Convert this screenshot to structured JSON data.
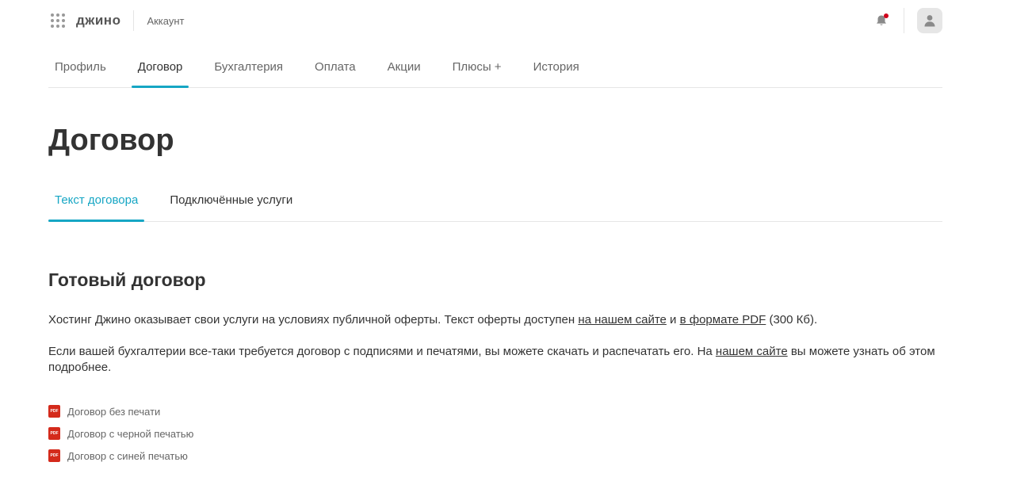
{
  "header": {
    "apps_icon": "apps-grid-icon",
    "logo": "джино",
    "account_label": "Аккаунт",
    "notification_icon": "bell-icon",
    "avatar_icon": "user-icon",
    "notification_dot_color": "#d0021b"
  },
  "nav": {
    "items": [
      {
        "label": "Профиль",
        "active": false
      },
      {
        "label": "Договор",
        "active": true
      },
      {
        "label": "Бухгалтерия",
        "active": false
      },
      {
        "label": "Оплата",
        "active": false
      },
      {
        "label": "Акции",
        "active": false
      },
      {
        "label": "Плюсы +",
        "active": false
      },
      {
        "label": "История",
        "active": false
      }
    ],
    "accent_color": "#16a6c4"
  },
  "page": {
    "title": "Договор"
  },
  "subnav": {
    "items": [
      {
        "label": "Текст договора",
        "active": true
      },
      {
        "label": "Подключённые услуги",
        "active": false
      }
    ]
  },
  "content": {
    "section_title": "Готовый договор",
    "para1": {
      "text_before": "Хостинг Джино оказывает свои услуги на условиях публичной оферты. Текст оферты доступен ",
      "link1": "на нашем сайте",
      "middle": " и ",
      "link2": "в формате PDF",
      "text_after": " (300 Кб)."
    },
    "para2": {
      "text_before": "Если вашей бухгалтерии все-таки требуется договор с подписями и печатями, вы можете скачать и распечатать его. На ",
      "link": "нашем сайте",
      "text_after": " вы можете узнать об этом подробнее."
    },
    "files": [
      {
        "label": "Договор без печати",
        "icon": "pdf-icon",
        "badge": "PDF"
      },
      {
        "label": "Договор с черной печатью",
        "icon": "pdf-icon",
        "badge": "PDF"
      },
      {
        "label": "Договор с синей печатью",
        "icon": "pdf-icon",
        "badge": "PDF"
      }
    ]
  }
}
